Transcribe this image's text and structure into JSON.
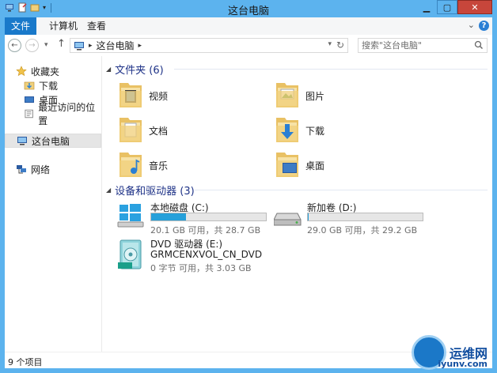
{
  "window": {
    "title": "这台电脑"
  },
  "ribbon": {
    "tabs": [
      "文件",
      "计算机",
      "查看"
    ]
  },
  "address": {
    "path": [
      "这台电脑"
    ]
  },
  "search": {
    "placeholder": "搜索\"这台电脑\""
  },
  "nav": {
    "favorites": "收藏夹",
    "favorites_items": [
      "下载",
      "桌面",
      "最近访问的位置"
    ],
    "this_pc": "这台电脑",
    "network": "网络"
  },
  "main": {
    "folders_header": "文件夹 (6)",
    "folders": [
      "视频",
      "图片",
      "文档",
      "下载",
      "音乐",
      "桌面"
    ],
    "devices_header": "设备和驱动器 (3)",
    "drives": [
      {
        "name": "本地磁盘 (C:)",
        "detail": "20.1 GB 可用，共 28.7 GB",
        "used_fraction": 0.3
      },
      {
        "name": "新加卷 (D:)",
        "detail": "29.0 GB 可用，共 29.2 GB",
        "used_fraction": 0.01
      },
      {
        "name": "DVD 驱动器 (E:)",
        "label": "GRMCENXVOL_CN_DVD",
        "detail": "0 字节 可用，共 3.03 GB"
      }
    ]
  },
  "status": {
    "item_count": "9 个项目"
  },
  "watermark": {
    "brand": "运维网",
    "site": "iyunv.com"
  },
  "colors": {
    "titlebar": "#5cb3ee",
    "file_tab": "#1979ca",
    "drive_fill": "#26a0da",
    "header_text": "#1e3287"
  }
}
